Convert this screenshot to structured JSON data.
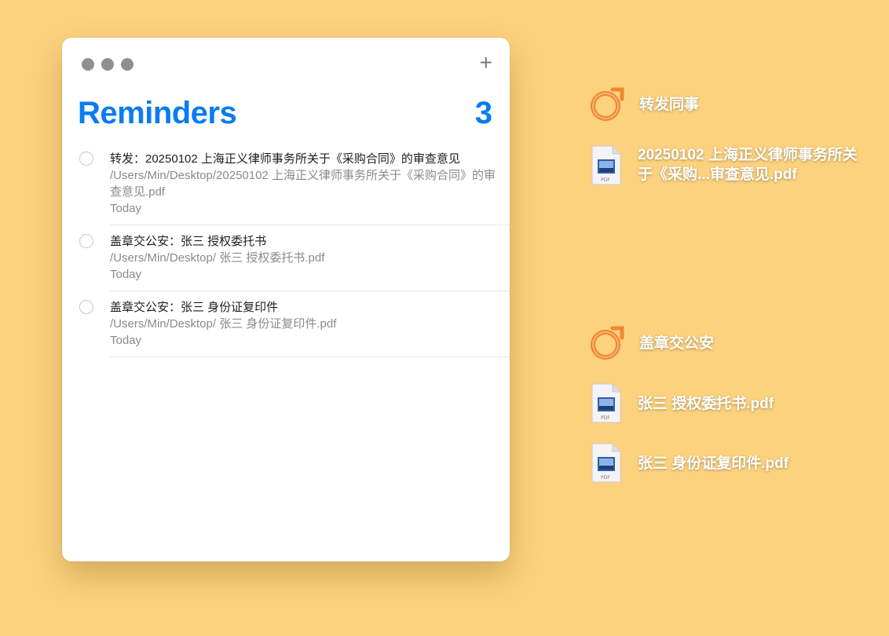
{
  "window": {
    "title": "Reminders",
    "count": "3",
    "add_label": "+"
  },
  "reminders": [
    {
      "title": "转发：20250102 上海正义律师事务所关于《采购合同》的审查意见",
      "path": "/Users/Min/Desktop/20250102 上海正义律师事务所关于《采购合同》的审查意见.pdf",
      "date": "Today"
    },
    {
      "title": "盖章交公安：张三 授权委托书",
      "path": "/Users/Min/Desktop/ 张三 授权委托书.pdf",
      "date": "Today"
    },
    {
      "title": "盖章交公安：张三 身份证复印件",
      "path": "/Users/Min/Desktop/ 张三 身份证复印件.pdf",
      "date": "Today"
    }
  ],
  "desktop": {
    "group1": {
      "label": "转发同事",
      "file": "20250102 上海正义律师事务所关于《采购...审查意见.pdf"
    },
    "group2": {
      "label": "盖章交公安",
      "files": [
        "张三 授权委托书.pdf",
        "张三 身份证复印件.pdf"
      ]
    },
    "icon_colors": {
      "ring": "#f2862e",
      "accent": "#0a7cf0"
    }
  }
}
